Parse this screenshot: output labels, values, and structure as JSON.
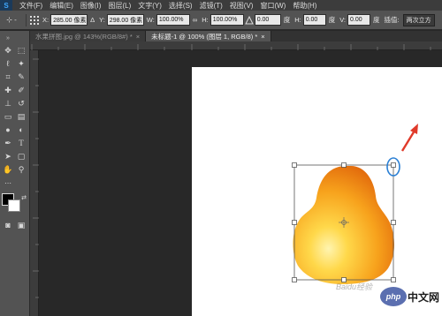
{
  "app": {
    "logo": "S"
  },
  "menubar": {
    "items": [
      "文件(F)",
      "编辑(E)",
      "图像(I)",
      "图层(L)",
      "文字(Y)",
      "选择(S)",
      "滤镜(T)",
      "视图(V)",
      "窗口(W)",
      "帮助(H)"
    ]
  },
  "options": {
    "tool_label": "⊹ -",
    "x_label": "X:",
    "x_value": "285.00 像素",
    "delta_symbol": "Δ",
    "y_label": "Y:",
    "y_value": "298.00 像素",
    "w_label": "W:",
    "w_value": "100.00%",
    "link_symbol": "∞",
    "h_label": "H:",
    "h_value": "100.00%",
    "angle_value": "0.00",
    "angle_unit": "度",
    "hskew_label": "H:",
    "hskew_value": "0.00",
    "hskew_unit": "度",
    "vskew_label": "V:",
    "vskew_value": "0.00",
    "vskew_unit": "度",
    "interp_label": "插值:",
    "interp_value": "两次立方"
  },
  "tabs": [
    {
      "label": "水果拼图.jpg @ 143%(RGB/8#) *",
      "close": "×",
      "active": false
    },
    {
      "label": "未标题-1 @ 100% (图层 1, RGB/8) *",
      "close": "×",
      "active": true
    }
  ],
  "watermark": {
    "baidu": "Baidu经验",
    "php_badge": "php",
    "cn_text": "中文网"
  },
  "colors": {
    "transform_circle": "#2a7fd4",
    "arrow": "#e03a2a",
    "fruit_light": "#ffd84a",
    "fruit_dark": "#f07a10"
  }
}
